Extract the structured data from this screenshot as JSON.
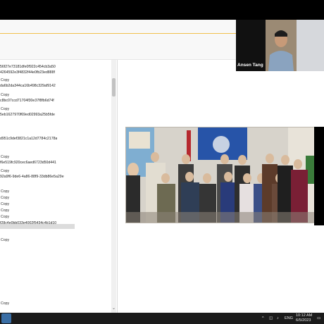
{
  "webcam": {
    "name": "Ansen Tang"
  },
  "list": {
    "rows": [
      {
        "kind": "hash",
        "text": "56f27e73181dfe0f922c454cb3a50"
      },
      {
        "kind": "hash",
        "text": "4264592e3f4832f44e0fb23ed888f"
      },
      {
        "kind": "copy",
        "text": "Copy"
      },
      {
        "kind": "hash",
        "text": "da6b2da344ca16b498c329af9142"
      },
      {
        "kind": "copy",
        "text": "Copy"
      },
      {
        "kind": "hash",
        "text": "c8bc07ccd71704f30e37f8fb6d74f"
      },
      {
        "kind": "copy",
        "text": "Copy"
      },
      {
        "kind": "hash",
        "text": "5eb1627970f69ed02993a25b5fde"
      },
      {
        "kind": "hash",
        "text": "d951c9def3821c1a12d7784c2178a"
      },
      {
        "kind": "copy",
        "text": "Copy"
      },
      {
        "kind": "hash",
        "text": "f6e519fc920cec6aed6723d50d441"
      },
      {
        "kind": "copy",
        "text": "Copy"
      },
      {
        "kind": "hash",
        "text": "92a9f6-9de6-4a86-88f9-33db86e5a29e"
      },
      {
        "kind": "copy",
        "text": "Copy"
      },
      {
        "kind": "copy",
        "text": "Copy"
      },
      {
        "kind": "copy",
        "text": "Copy"
      },
      {
        "kind": "copy",
        "text": "Copy"
      },
      {
        "kind": "copy",
        "text": "Copy"
      },
      {
        "kind": "hash",
        "text": "f28c4e0bb033e4002f5434c4b1d10"
      },
      {
        "kind": "copy",
        "text": "Copy"
      },
      {
        "kind": "copy",
        "text": "Copy"
      }
    ]
  },
  "taskbar": {
    "language": "ENG",
    "time": "10:12 AM",
    "date": "6/5/2023"
  }
}
